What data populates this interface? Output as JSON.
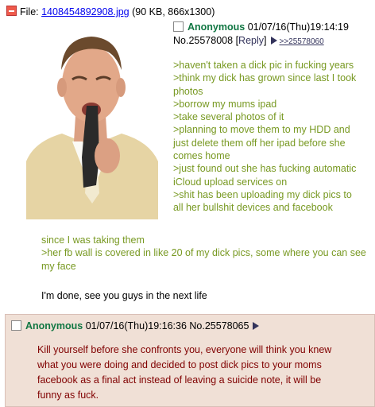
{
  "op": {
    "file_label": "File:",
    "file_name": "1408454892908.jpg",
    "file_meta": "(90 KB, 866x1300)",
    "name": "Anonymous",
    "datetime": "01/07/16(Thu)19:14:19",
    "post_no": "No.25578008",
    "reply_label": "Reply",
    "backlink": ">>25578060",
    "body_right": [
      ">haven't taken a dick pic in fucking years",
      ">think my dick has grown since last I took photos",
      ">borrow my mums ipad",
      ">take several photos of it",
      ">planning to move them to my HDD and just delete them off her ipad before she comes home",
      ">just found out she has fucking automatic iCloud upload services on",
      ">shit has been uploading my dick pics to all her bullshit devices and facebook"
    ],
    "body_full": [
      "since I was taking them",
      ">her fb wall is covered in like 20 of my dick pics, some where you can see my face"
    ],
    "body_last": "I'm done, see you guys in the next life"
  },
  "reply": {
    "name": "Anonymous",
    "datetime": "01/07/16(Thu)19:16:36",
    "post_no": "No.25578065",
    "body": "Kill yourself before she confronts you, everyone will think you knew what you were doing and decided to post dick pics to your moms facebook as a final act instead of leaving a suicide note, it will be funny as fuck."
  },
  "colors": {
    "name_green": "#117743",
    "greentext": "#789922",
    "reply_text": "#800000",
    "reply_bg": "#f0e0d6"
  }
}
